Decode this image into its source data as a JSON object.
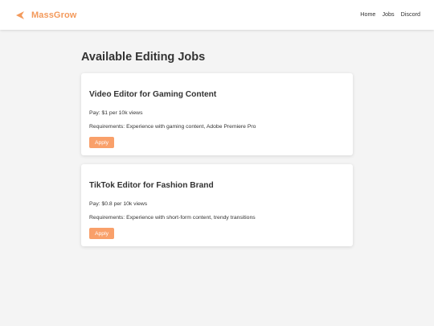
{
  "header": {
    "brand_name": "MassGrow",
    "brand_icon": "arrow-left-icon",
    "brand_color": "#f39a5c",
    "nav": [
      {
        "label": "Home"
      },
      {
        "label": "Jobs"
      },
      {
        "label": "Discord"
      }
    ]
  },
  "main": {
    "title": "Available Editing Jobs",
    "jobs": [
      {
        "title": "Video Editor for Gaming Content",
        "pay": "Pay: $1 per 10k views",
        "requirements": "Requirements: Experience with gaming content, Adobe Premiere Pro",
        "apply_label": "Apply"
      },
      {
        "title": "TikTok Editor for Fashion Brand",
        "pay": "Pay: $0.8 per 10k views",
        "requirements": "Requirements: Experience with short-form content, trendy transitions",
        "apply_label": "Apply"
      }
    ]
  },
  "colors": {
    "accent": "#f9a06a",
    "background": "#f4f4f4",
    "card": "#ffffff",
    "text": "#333333"
  }
}
